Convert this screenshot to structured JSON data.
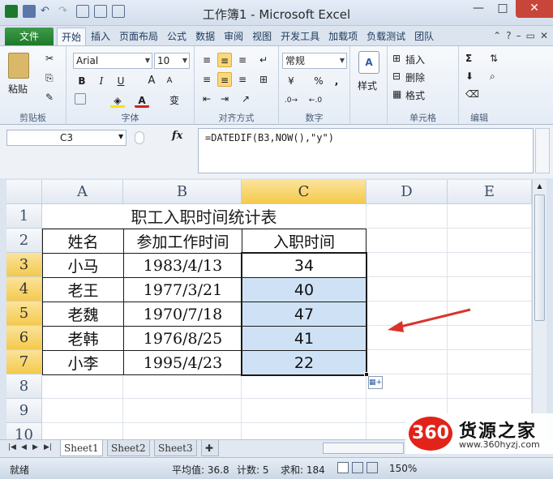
{
  "window": {
    "title": "工作簿1 - Microsoft Excel",
    "controls": {
      "minimize": "—",
      "maximize": "□",
      "close": "✕"
    }
  },
  "ribbon_tabs": [
    "文件",
    "开始",
    "插入",
    "页面布局",
    "公式",
    "数据",
    "审阅",
    "视图",
    "开发工具",
    "加载项",
    "负载测试",
    "团队"
  ],
  "active_tab": "开始",
  "ribbon": {
    "clipboard": {
      "paste": "粘贴",
      "label": "剪贴板"
    },
    "font": {
      "name": "Arial",
      "size": "10",
      "bold": "B",
      "italic": "I",
      "underline": "U",
      "grow": "A",
      "shrink": "A",
      "wen": "变",
      "label": "字体"
    },
    "alignment": {
      "label": "对齐方式"
    },
    "number": {
      "format": "常规",
      "percent": "%",
      "comma": ",",
      "label": "数字"
    },
    "styles": {
      "label": "样式"
    },
    "cells": {
      "insert": "插入",
      "delete": "删除",
      "format": "格式",
      "label": "单元格"
    },
    "editing": {
      "sum": "Σ",
      "label": "编辑"
    }
  },
  "formula_bar": {
    "name_box": "C3",
    "fx": "fx",
    "formula": "=DATEDIF(B3,NOW(),\"y\")"
  },
  "sheet": {
    "columns": [
      "A",
      "B",
      "C",
      "D",
      "E"
    ],
    "rows": [
      "1",
      "2",
      "3",
      "4",
      "5",
      "6",
      "7",
      "8",
      "9",
      "10"
    ],
    "selected_column": "C",
    "selected_rows": [
      "3",
      "4",
      "5",
      "6",
      "7"
    ],
    "title": "职工入职时间统计表",
    "headers": [
      "姓名",
      "参加工作时间",
      "入职时间"
    ],
    "records": [
      {
        "name": "小马",
        "date": "1983/4/13",
        "years": "34"
      },
      {
        "name": "老王",
        "date": "1977/3/21",
        "years": "40"
      },
      {
        "name": "老魏",
        "date": "1970/7/18",
        "years": "47"
      },
      {
        "name": "老韩",
        "date": "1976/8/25",
        "years": "41"
      },
      {
        "name": "小李",
        "date": "1995/4/23",
        "years": "22"
      }
    ]
  },
  "sheet_tabs": [
    "Sheet1",
    "Sheet2",
    "Sheet3"
  ],
  "active_sheet": "Sheet1",
  "status": {
    "mode": "就绪",
    "average": "平均值: 36.8",
    "count": "计数: 5",
    "sum": "求和: 184",
    "zoom": "150%"
  },
  "watermark": {
    "logo": "360",
    "name": "货源之家",
    "url": "www.360hyzj.com"
  },
  "colors": {
    "accent_green": "#217346",
    "selection": "#cfe2f5",
    "arrow": "#d9342b",
    "header_selected": "#f4c94c"
  }
}
